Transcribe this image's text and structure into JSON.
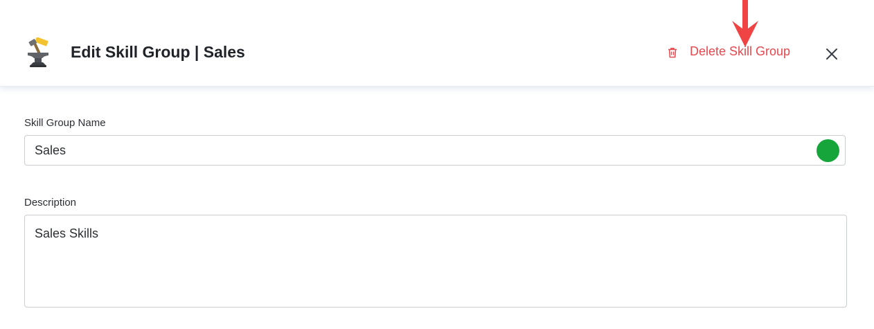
{
  "header": {
    "title": "Edit Skill Group | Sales",
    "icon": "anvil-hammer-icon",
    "delete_label": "Delete Skill Group",
    "delete_icon": "trash-icon",
    "close_icon": "close-icon"
  },
  "form": {
    "name_label": "Skill Group Name",
    "name_value": "Sales",
    "status_color": "#16a53a",
    "description_label": "Description",
    "description_value": "Sales Skills"
  },
  "colors": {
    "danger": "#e5484d",
    "annotation_arrow": "#f04444",
    "status": "#16a53a"
  }
}
